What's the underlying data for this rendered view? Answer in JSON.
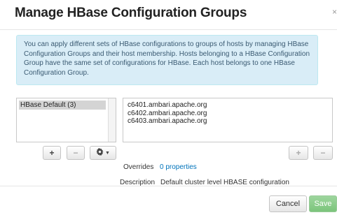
{
  "dialog": {
    "title": "Manage HBase Configuration Groups",
    "close_label": "×"
  },
  "info": {
    "text": "You can apply different sets of HBase configurations to groups of hosts by managing HBase Configuration Groups and their host membership. Hosts belonging to a HBase Configuration Group have the same set of configurations for HBase. Each host belongs to one HBase Configuration Group."
  },
  "groups": {
    "items": [
      {
        "label": "HBase Default (3)",
        "selected": true
      }
    ]
  },
  "hosts": {
    "items": [
      "c6401.ambari.apache.org",
      "c6402.ambari.apache.org",
      "c6403.ambari.apache.org"
    ]
  },
  "group_buttons": {
    "add": "+",
    "remove": "−",
    "settings_icon": "gear-icon"
  },
  "host_buttons": {
    "add": "+",
    "remove": "−"
  },
  "details": {
    "overrides_label": "Overrides",
    "overrides_value": "0 properties",
    "description_label": "Description",
    "description_value": "Default cluster level HBASE configuration"
  },
  "footer": {
    "cancel_label": "Cancel",
    "save_label": "Save"
  },
  "colors": {
    "info_bg": "#d9edf7",
    "link": "#0073bb",
    "save": "#5bb75b"
  }
}
